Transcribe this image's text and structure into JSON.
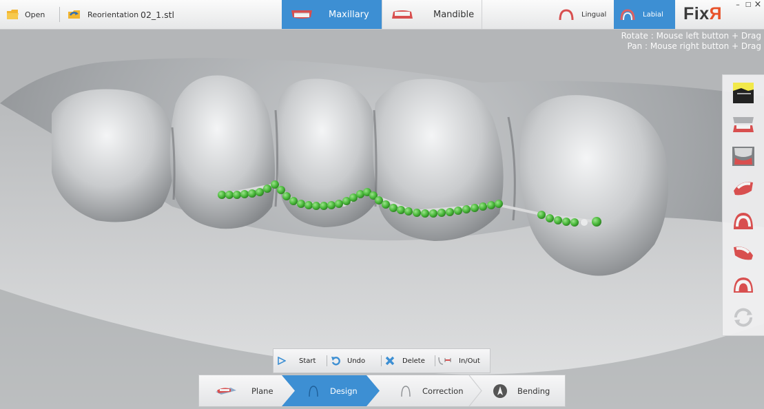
{
  "toolbar": {
    "open_label": "Open",
    "reorientation_label": "Reorientation",
    "file_name": "02_1.stl"
  },
  "jaw_tabs": {
    "maxillary_label": "Maxillary",
    "mandible_label": "Mandible",
    "active": "Maxillary"
  },
  "view_side": {
    "lingual_label": "Lingual",
    "labial_label": "Labial",
    "active": "Labial"
  },
  "logo": {
    "text": "Fix",
    "accent_text": "Я"
  },
  "window_controls": {
    "minimize": "–",
    "maximize": "□",
    "close": "×"
  },
  "hints": {
    "rotate": "Rotate : Mouse left button + Drag",
    "pan": "Pan : Mouse right button + Drag"
  },
  "palette": {
    "icons": [
      "wire-profile-icon",
      "occlusal-open-icon",
      "arch-front-icon",
      "jaw-right-icon",
      "jaw-front-icon",
      "jaw-left-icon",
      "jaw-bottom-icon",
      "reset-rotate-icon"
    ]
  },
  "tools": {
    "start_label": "Start",
    "undo_label": "Undo",
    "delete_label": "Delete",
    "inout_label": "In/Out"
  },
  "steps": {
    "plane_label": "Plane",
    "design_label": "Design",
    "correction_label": "Correction",
    "bending_label": "Bending",
    "active": "Design"
  },
  "colors": {
    "accent": "#3d8fd3",
    "logo_accent": "#e8522a",
    "wire_point": "#49b83a",
    "delete_icon": "#3d8fd3"
  }
}
